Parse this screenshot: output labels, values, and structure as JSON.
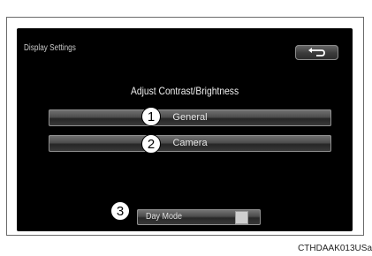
{
  "screen": {
    "title": "Display Settings",
    "back_icon": "return-arrow-icon",
    "subtitle": "Adjust Contrast/Brightness",
    "buttons": [
      {
        "label": "General",
        "callout": "1"
      },
      {
        "label": "Camera",
        "callout": "2"
      }
    ],
    "day_mode": {
      "label": "Day Mode",
      "callout": "3",
      "indicator_on": true
    }
  },
  "caption": "CTHDAAK013USa",
  "colors": {
    "screen_bg": "#000000",
    "button_face": "#4e4e4e",
    "text": "#e6e6e6"
  }
}
